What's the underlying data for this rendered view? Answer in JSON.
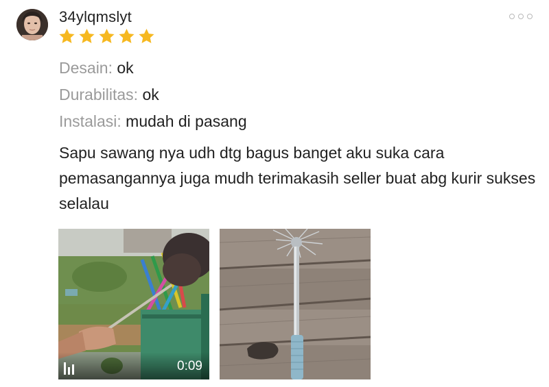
{
  "review": {
    "username": "34ylqmslyt",
    "rating": 5,
    "rating_max": 5,
    "star_color": "#F6B820",
    "more_icon": "more-horizontal-icon",
    "attributes": [
      {
        "key": "Desain:",
        "value": "ok"
      },
      {
        "key": "Durabilitas:",
        "value": "ok"
      },
      {
        "key": "Instalasi:",
        "value": "mudah di pasang"
      }
    ],
    "comment": "Sapu sawang nya udh dtg bagus banget aku suka cara pemasangannya juga mudh terimakasih seller buat abg kurir sukses selalau",
    "media": [
      {
        "type": "video",
        "duration": "0:09",
        "icon": "video-icon"
      },
      {
        "type": "photo"
      }
    ]
  }
}
